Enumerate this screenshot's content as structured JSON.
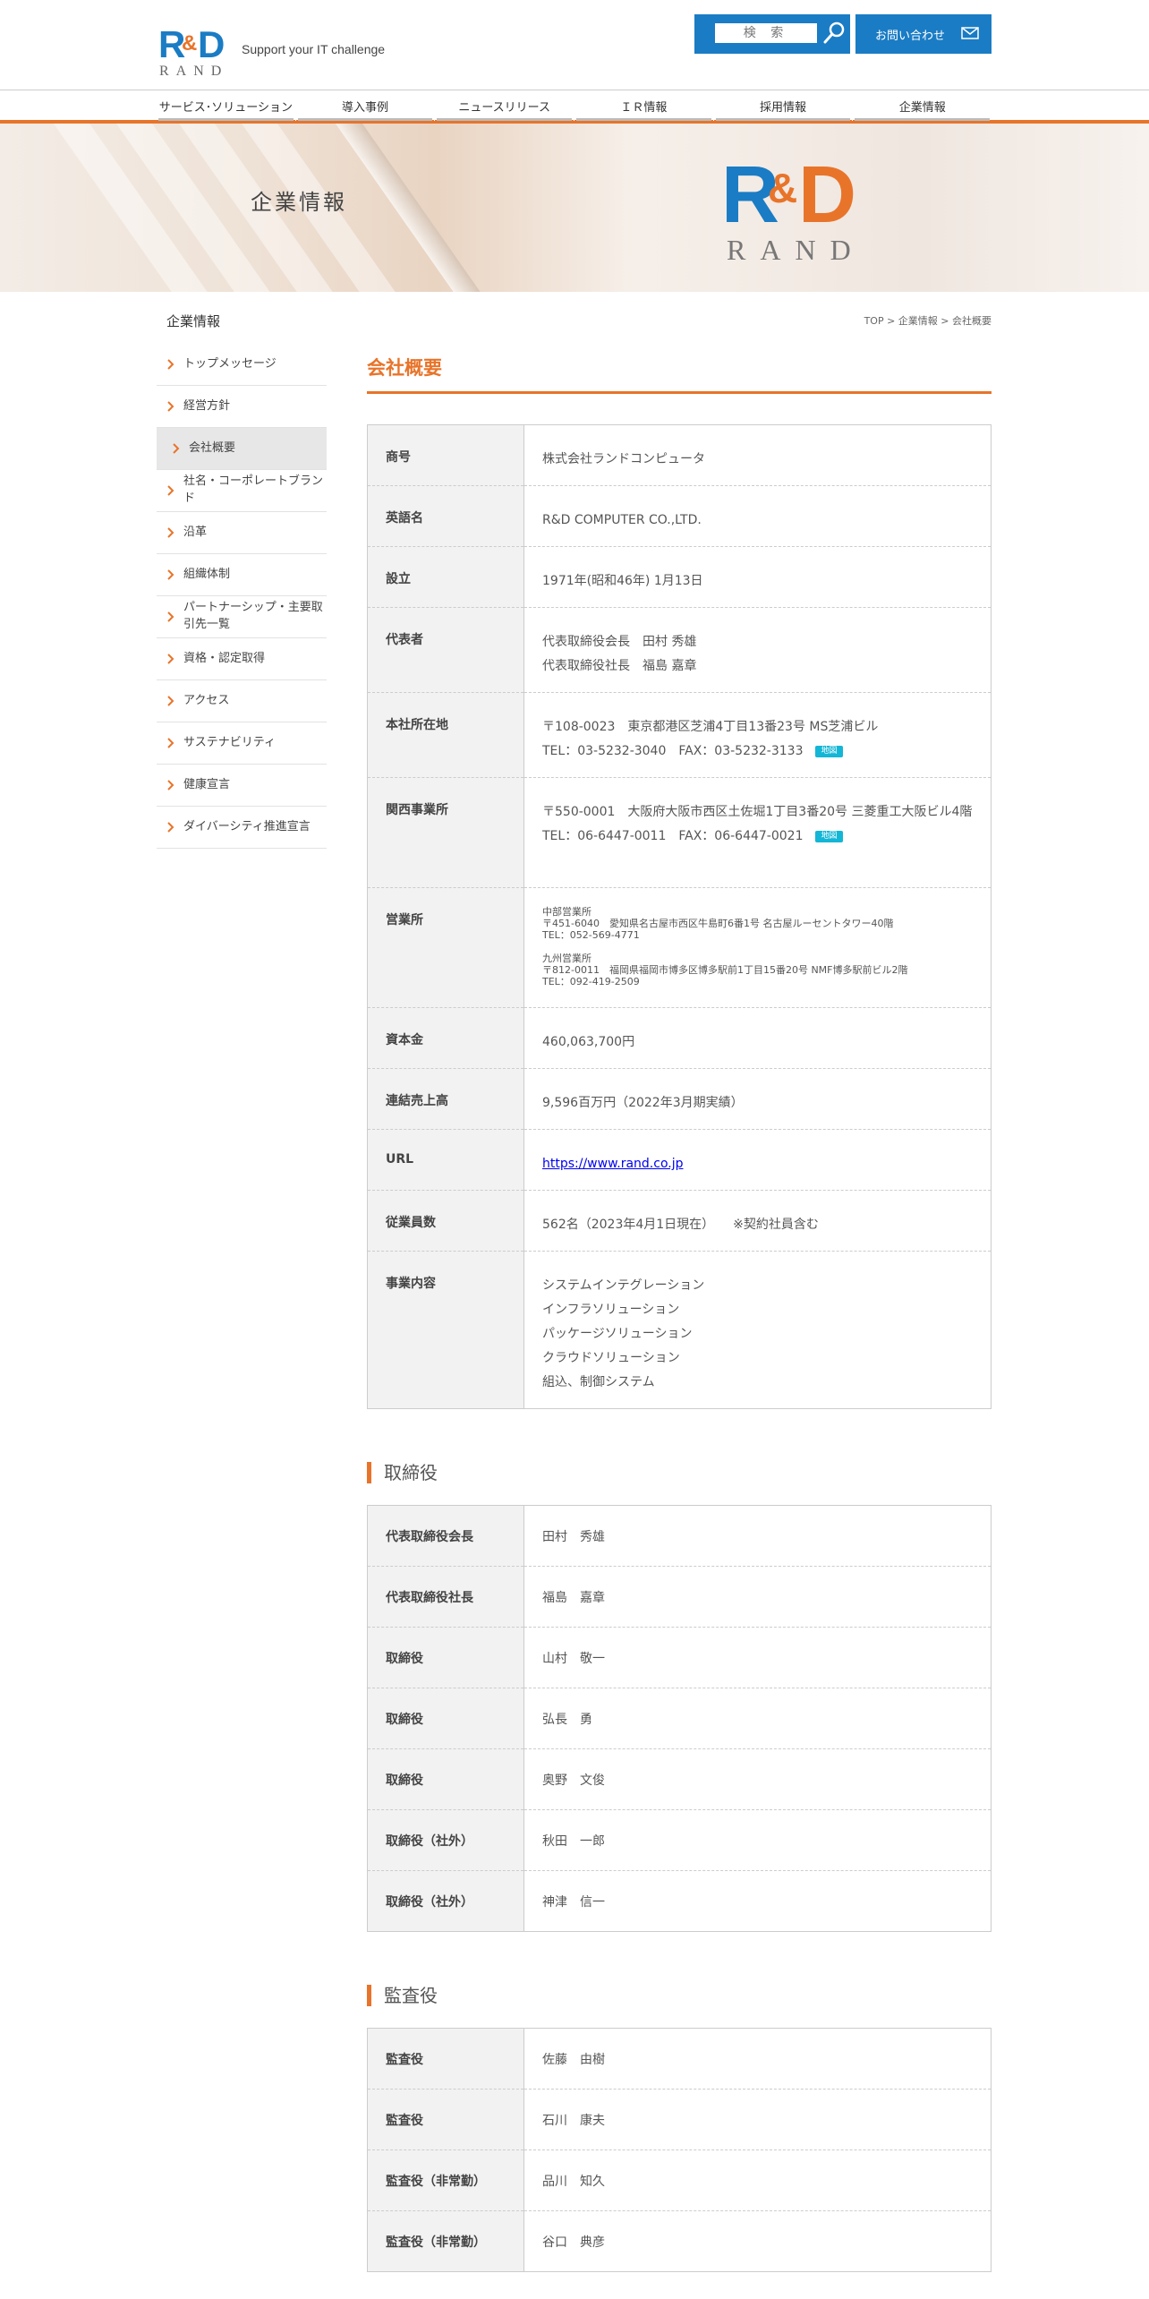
{
  "header": {
    "tagline": "Support your IT challenge",
    "search_label": "検 索",
    "contact_label": "お問い合わせ",
    "logo_text": "R&D RAND"
  },
  "nav": {
    "items": [
      "サービス･ソリューション",
      "導入事例",
      "ニュースリリース",
      "ＩＲ情報",
      "採用情報",
      "企業情報"
    ]
  },
  "banner": {
    "title": "企業情報"
  },
  "sidebar": {
    "title": "企業情報",
    "items": [
      {
        "label": "トップメッセージ",
        "active": false
      },
      {
        "label": "経営方針",
        "active": false
      },
      {
        "label": "会社概要",
        "active": true
      },
      {
        "label": "社名・コーポレートブランド",
        "active": false
      },
      {
        "label": "沿革",
        "active": false
      },
      {
        "label": "組織体制",
        "active": false
      },
      {
        "label": "パートナーシップ・主要取引先一覧",
        "active": false
      },
      {
        "label": "資格・認定取得",
        "active": false
      },
      {
        "label": "アクセス",
        "active": false
      },
      {
        "label": "サステナビリティ",
        "active": false
      },
      {
        "label": "健康宣言",
        "active": false
      },
      {
        "label": "ダイバーシティ推進宣言",
        "active": false
      }
    ]
  },
  "breadcrumb": {
    "text": "TOP > 企業情報 > 会社概要"
  },
  "main": {
    "title": "会社概要",
    "overview": [
      {
        "label": "商号",
        "lines": [
          "株式会社ランドコンピュータ"
        ],
        "height": 68
      },
      {
        "label": "英語名",
        "lines": [
          "R&D COMPUTER CO.,LTD."
        ],
        "height": 68
      },
      {
        "label": "設立",
        "lines": [
          "1971年(昭和46年) 1月13日"
        ],
        "height": 68
      },
      {
        "label": "代表者",
        "lines": [
          "代表取締役会長　田村 秀雄",
          "代表取締役社長　福島 嘉章"
        ],
        "height": 95
      },
      {
        "label": "本社所在地",
        "lines": [
          "〒108-0023　東京都港区芝浦4丁目13番23号 MS芝浦ビル",
          "TEL：03-5232-3040　FAX：03-5232-3133"
        ],
        "map": "地図",
        "height": 95
      },
      {
        "label": "関西事業所",
        "lines": [
          "〒550-0001　大阪府大阪市西区土佐堀1丁目3番20号 三菱重工大阪ビル4階",
          "TEL：06-6447-0011　FAX：06-6447-0021"
        ],
        "map": "地図",
        "height": 123
      },
      {
        "label": "営業所",
        "small": true,
        "lines": [
          "中部営業所",
          "〒451-6040　愛知県名古屋市西区牛島町6番1号 名古屋ルーセントタワー40階",
          "TEL：052-569-4771",
          "",
          "九州営業所",
          "〒812-0011　福岡県福岡市博多区博多駅前1丁目15番20号 NMF博多駅前ビル2階",
          "TEL：092-419-2509"
        ],
        "height": 134
      },
      {
        "label": "資本金",
        "lines": [
          "460,063,700円"
        ],
        "height": 68
      },
      {
        "label": "連結売上高",
        "lines": [
          "9,596百万円（2022年3月期実績）"
        ],
        "height": 68
      },
      {
        "label": "URL",
        "link": "https://www.rand.co.jp",
        "lines": [],
        "height": 68
      },
      {
        "label": "従業員数",
        "lines": [
          "562名（2023年4月1日現在）　　※契約社員含む"
        ],
        "height": 68
      },
      {
        "label": "事業内容",
        "lines": [
          "システムインテグレーション",
          "インフラソリューション",
          "パッケージソリューション",
          "クラウドソリューション",
          "組込、制御システム"
        ],
        "height": 176
      }
    ],
    "directors_title": "取締役",
    "directors": [
      {
        "role": "代表取締役会長",
        "name": "田村　秀雄"
      },
      {
        "role": "代表取締役社長",
        "name": "福島　嘉章"
      },
      {
        "role": "取締役",
        "name": "山村　敬一"
      },
      {
        "role": "取締役",
        "name": "弘長　勇"
      },
      {
        "role": "取締役",
        "name": "奥野　文俊"
      },
      {
        "role": "取締役（社外）",
        "name": "秋田　一郎"
      },
      {
        "role": "取締役（社外）",
        "name": "神津　信一"
      }
    ],
    "auditors_title": "監査役",
    "auditors": [
      {
        "role": "監査役",
        "name": "佐藤　由樹"
      },
      {
        "role": "監査役",
        "name": "石川　康夫"
      },
      {
        "role": "監査役（非常勤）",
        "name": "品川　知久"
      },
      {
        "role": "監査役（非常勤）",
        "name": "谷口　典彦"
      }
    ]
  },
  "colors": {
    "accent": "#e8742a",
    "brand_blue": "#1a7cc4",
    "map_tag": "#14b6d6"
  }
}
